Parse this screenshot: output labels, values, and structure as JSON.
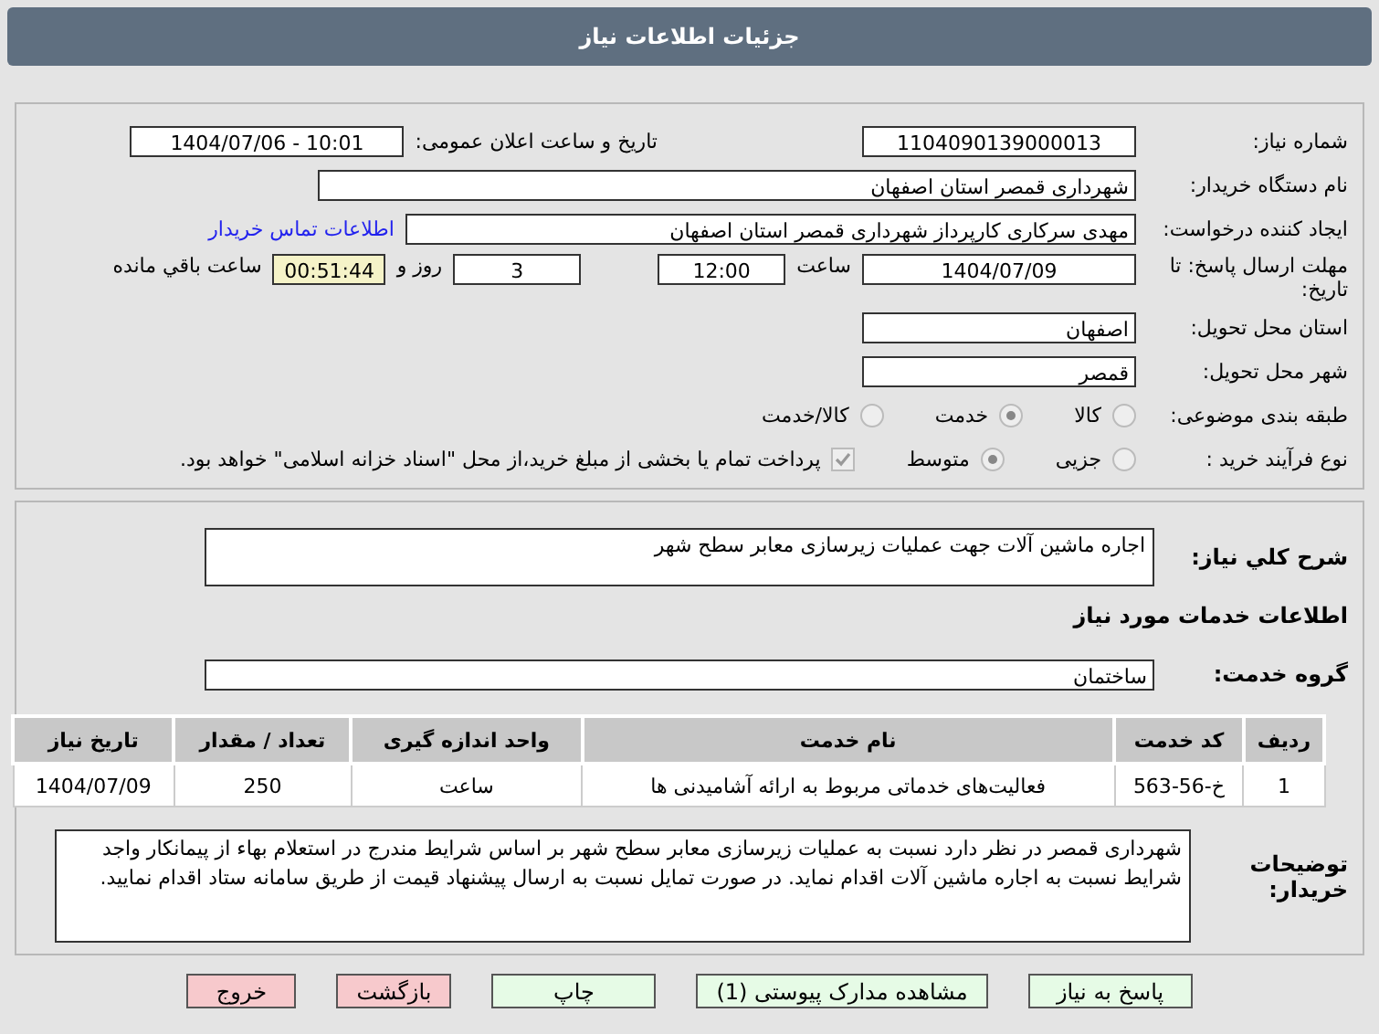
{
  "window": {
    "title": "جزئیات اطلاعات نیاز"
  },
  "need_number": {
    "label": "شماره نیاز:",
    "value": "1104090139000013"
  },
  "announce": {
    "label": "تاریخ و ساعت اعلان عمومی:",
    "value": "1404/07/06 - 10:01"
  },
  "buyer": {
    "label": "نام دستگاه خریدار:",
    "value": "شهرداری قمصر استان اصفهان"
  },
  "creator": {
    "label": "ایجاد کننده درخواست:",
    "value": "مهدی سرکاری کارپرداز شهرداری قمصر استان اصفهان",
    "link": "اطلاعات تماس خریدار"
  },
  "deadline": {
    "label": "مهلت ارسال پاسخ: تا تاریخ:",
    "date": "1404/07/09",
    "time_label": "ساعت",
    "time": "12:00",
    "days": "3",
    "days_label": "روز و",
    "remaining": "00:51:44",
    "remaining_label": "ساعت باقي مانده"
  },
  "province": {
    "label": "استان محل تحویل:",
    "value": "اصفهان"
  },
  "city": {
    "label": "شهر محل تحویل:",
    "value": "قمصر"
  },
  "category": {
    "label": "طبقه بندی موضوعی:",
    "options": [
      {
        "label": "کالا",
        "selected": false
      },
      {
        "label": "خدمت",
        "selected": true
      },
      {
        "label": "کالا/خدمت",
        "selected": false
      }
    ]
  },
  "process": {
    "label": "نوع فرآیند خرید :",
    "options": [
      {
        "label": "جزیی",
        "selected": false
      },
      {
        "label": "متوسط",
        "selected": true
      }
    ],
    "payment": {
      "checked": true,
      "text": "پرداخت تمام یا بخشی از مبلغ خرید،از محل \"اسناد خزانه اسلامی\" خواهد بود."
    }
  },
  "description": {
    "label": "شرح کلي نیاز:",
    "value": "اجاره ماشین آلات جهت عملیات زیرسازی معابر سطح شهر"
  },
  "services_heading": "اطلاعات خدمات مورد نیاز",
  "service_group": {
    "label": "گروه خدمت:",
    "value": "ساختمان"
  },
  "table": {
    "columns": [
      "ردیف",
      "کد خدمت",
      "نام خدمت",
      "واحد اندازه گیری",
      "تعداد / مقدار",
      "تاریخ نیاز"
    ],
    "rows": [
      [
        "1",
        "خ-56-563",
        "فعالیت‌های خدماتی مربوط به ارائه آشامیدنی ها",
        "ساعت",
        "250",
        "1404/07/09"
      ]
    ]
  },
  "buyer_notes": {
    "label": "توضیحات خریدار:",
    "value": "شهرداری قمصر در نظر دارد نسبت به عملیات زیرسازی معابر سطح شهر بر اساس شرایط مندرج در استعلام بهاء از پیمانکار واجد شرایط نسبت به اجاره ماشین آلات اقدام نماید. در صورت تمایل نسبت به ارسال پیشنهاد قیمت از طریق سامانه ستاد اقدام نمایید."
  },
  "buttons": [
    {
      "label": "پاسخ به نیاز",
      "kind": "primary"
    },
    {
      "label": "مشاهده مدارک پیوستی (1)",
      "kind": "primary"
    },
    {
      "label": "چاپ",
      "kind": "primary"
    },
    {
      "label": "بازگشت",
      "kind": "danger"
    },
    {
      "label": "خروج",
      "kind": "danger"
    }
  ]
}
